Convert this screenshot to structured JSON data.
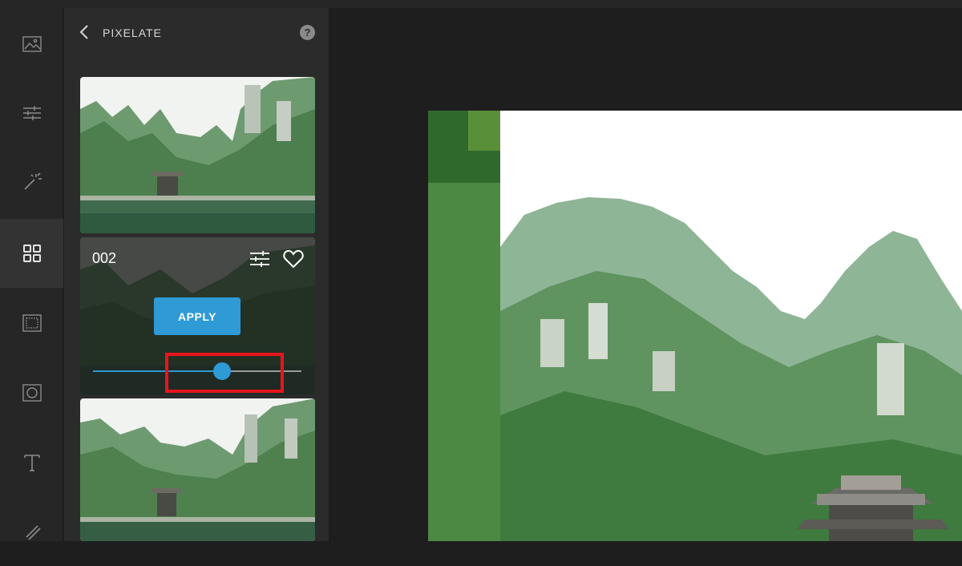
{
  "rail": {
    "items": [
      {
        "icon": "image-icon",
        "active": false
      },
      {
        "icon": "sliders-icon",
        "active": false
      },
      {
        "icon": "magic-wand-icon",
        "active": false
      },
      {
        "icon": "grid-icon",
        "active": true
      },
      {
        "icon": "texture-icon",
        "active": false
      },
      {
        "icon": "frame-icon",
        "active": false
      },
      {
        "icon": "text-icon",
        "active": false
      },
      {
        "icon": "brush-icon",
        "active": false
      }
    ]
  },
  "panel": {
    "title": "PIXELATE",
    "help_label": "?",
    "active_card": {
      "name": "002",
      "apply_label": "APPLY",
      "slider_value": 0.62
    }
  },
  "colors": {
    "accent": "#2e9ad6",
    "highlight": "#e8141c",
    "panel_bg": "#2b2b2b",
    "rail_bg": "#262626"
  }
}
